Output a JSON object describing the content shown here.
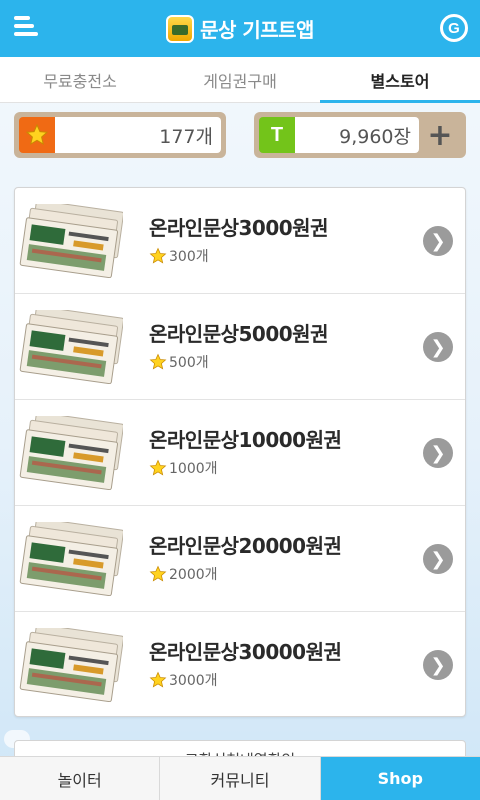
{
  "header": {
    "title": "문상 기프트앱",
    "menu_icon": "hamburger-menu-icon",
    "logo_icon": "culture-voucher-logo-icon",
    "right_icon": "g-chat-icon",
    "right_icon_letter": "G",
    "color": "#2cb4ec"
  },
  "tabs": [
    {
      "label": "무료충전소",
      "active": false
    },
    {
      "label": "게임권구매",
      "active": false
    },
    {
      "label": "별스토어",
      "active": true
    }
  ],
  "balances": {
    "stars": {
      "value": "177개",
      "icon": "star-icon"
    },
    "tickets": {
      "value": "9,960장",
      "icon": "t-letter-icon",
      "icon_letter": "T",
      "plus_icon": "plus-icon"
    }
  },
  "products": [
    {
      "title": "온라인문상3000원권",
      "price": "300개"
    },
    {
      "title": "온라인문상5000원권",
      "price": "500개"
    },
    {
      "title": "온라인문상10000원권",
      "price": "1000개"
    },
    {
      "title": "온라인문상20000원권",
      "price": "2000개"
    },
    {
      "title": "온라인문상30000원권",
      "price": "3000개"
    }
  ],
  "peek_text": "교환신청내역확인",
  "bottom_nav": [
    {
      "label": "놀이터",
      "active": false
    },
    {
      "label": "커뮤니티",
      "active": false
    },
    {
      "label": "Shop",
      "active": true
    }
  ],
  "colors": {
    "accent": "#2cb4ec",
    "star_box": "#f06a14",
    "ticket_box": "#73c41a",
    "balance_bg": "#c9b49a"
  }
}
